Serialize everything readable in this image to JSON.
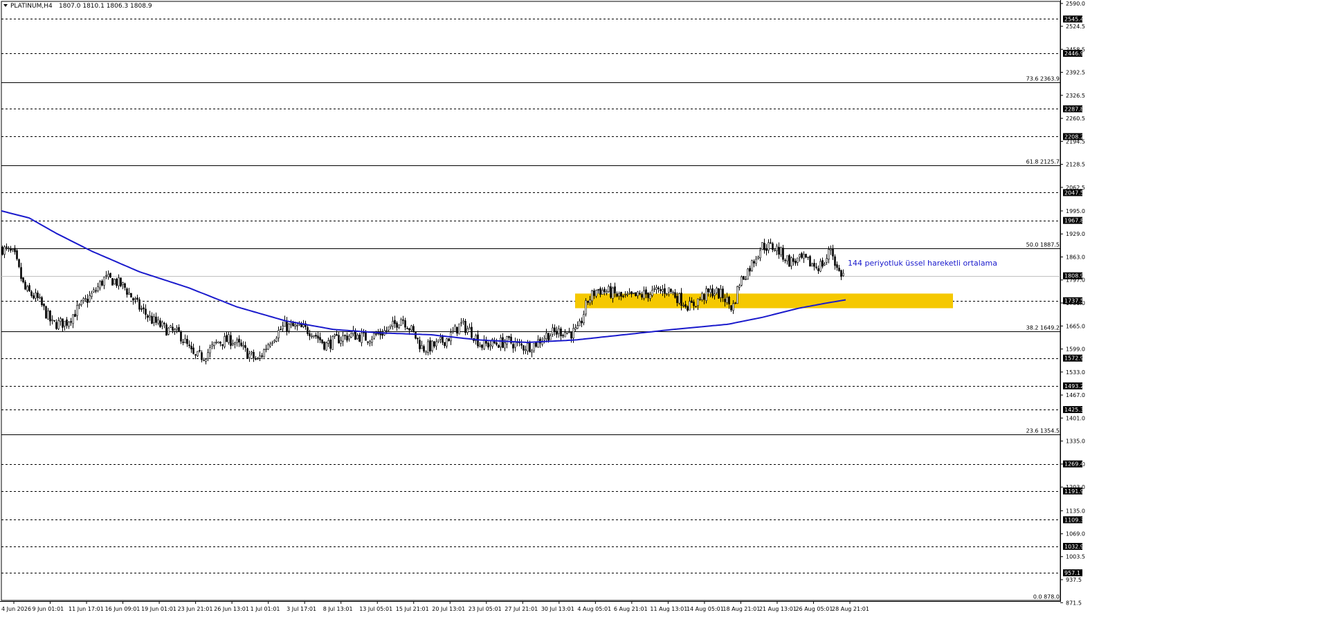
{
  "header": {
    "symbol": "PLATINUM,H4",
    "ohlc": "1807.0 1810.1 1806.3 1808.9"
  },
  "colors": {
    "background": "#ffffff",
    "candle": "#000000",
    "ema": "#1a1acc",
    "zone": "#f5c800",
    "annotation": "#1a1acc",
    "price_tag_bg": "#000000",
    "price_tag_text": "#ffffff"
  },
  "chart_data": {
    "type": "candlestick",
    "symbol": "PLATINUM",
    "timeframe": "H4",
    "ylim": [
      878.0,
      2590.0
    ],
    "price_scale_ticks": [
      "2590.0",
      "2524.5",
      "2458.5",
      "2392.5",
      "2326.5",
      "2260.5",
      "2194.5",
      "2128.5",
      "2062.5",
      "1995.0",
      "1929.0",
      "1863.0",
      "1797.0",
      "1731.0",
      "1665.0",
      "1599.0",
      "1533.0",
      "1467.0",
      "1401.0",
      "1335.0",
      "1269.0",
      "1203.0",
      "1135.0",
      "1069.0",
      "1003.5",
      "937.5",
      "871.5"
    ],
    "time_labels": [
      "4 Jun 2026",
      "9 Jun 01:01",
      "11 Jun 17:01",
      "16 Jun 09:01",
      "19 Jun 01:01",
      "23 Jun 21:01",
      "26 Jun 13:01",
      "1 Jul 01:01",
      "3 Jul 17:01",
      "8 Jul 13:01",
      "13 Jul 05:01",
      "15 Jul 21:01",
      "20 Jul 13:01",
      "23 Jul 05:01",
      "27 Jul 21:01",
      "30 Jul 13:01",
      "4 Aug 05:01",
      "6 Aug 21:01",
      "11 Aug 13:01",
      "14 Aug 05:01",
      "18 Aug 21:01",
      "21 Aug 13:01",
      "26 Aug 05:01",
      "28 Aug 21:01"
    ],
    "horizontal_levels": [
      {
        "price": 2545.4,
        "label": "2545.4"
      },
      {
        "price": 2446.9,
        "label": "2446.9"
      },
      {
        "price": 2287.8,
        "label": "2287.8"
      },
      {
        "price": 2208.2,
        "label": "2208.2"
      },
      {
        "price": 2047.5,
        "label": "2047.5"
      },
      {
        "price": 1967.8,
        "label": "1967.8"
      },
      {
        "price": 1737.5,
        "label": "1737.5"
      },
      {
        "price": 1572.9,
        "label": "1572.9"
      },
      {
        "price": 1493.2,
        "label": "1493.2"
      },
      {
        "price": 1425.3,
        "label": "1425.3"
      },
      {
        "price": 1269.4,
        "label": "1269.4"
      },
      {
        "price": 1191.9,
        "label": "1191.9"
      },
      {
        "price": 1109.3,
        "label": "1109.3"
      },
      {
        "price": 1032.9,
        "label": "1032.9"
      },
      {
        "price": 957.1,
        "label": "957.1"
      }
    ],
    "fibonacci_levels": [
      {
        "level": "73.6",
        "price": 2363.9,
        "label": "73.6 2363.9"
      },
      {
        "level": "61.8",
        "price": 2125.7,
        "label": "61.8 2125.7"
      },
      {
        "level": "50.0",
        "price": 1887.5,
        "label": "50.0 1887.5"
      },
      {
        "level": "38.2",
        "price": 1649.2,
        "label": "38.2 1649.2"
      },
      {
        "level": "23.6",
        "price": 1354.5,
        "label": "23.6 1354.5"
      },
      {
        "level": "0.0",
        "price": 878.0,
        "label": "0.0 878.0"
      }
    ],
    "current_price": {
      "price": 1808.9,
      "label": "1808.9"
    },
    "zone": {
      "price_top": 1758.0,
      "price_bottom": 1716.0,
      "start_label": "4 Aug 05:01",
      "end_label": "28 Aug 21:01"
    },
    "annotation": "144 periyotluk üssel hareketli ortalama",
    "price_path": [
      [
        0,
        1890
      ],
      [
        20,
        1870
      ],
      [
        35,
        1770
      ],
      [
        55,
        1740
      ],
      [
        75,
        1670
      ],
      [
        95,
        1675
      ],
      [
        115,
        1720
      ],
      [
        135,
        1760
      ],
      [
        150,
        1800
      ],
      [
        165,
        1795
      ],
      [
        180,
        1775
      ],
      [
        200,
        1720
      ],
      [
        220,
        1680
      ],
      [
        240,
        1655
      ],
      [
        260,
        1640
      ],
      [
        280,
        1575
      ],
      [
        295,
        1580
      ],
      [
        315,
        1620
      ],
      [
        335,
        1625
      ],
      [
        355,
        1590
      ],
      [
        372,
        1565
      ],
      [
        390,
        1625
      ],
      [
        410,
        1665
      ],
      [
        430,
        1660
      ],
      [
        450,
        1650
      ],
      [
        470,
        1610
      ],
      [
        490,
        1630
      ],
      [
        510,
        1640
      ],
      [
        530,
        1630
      ],
      [
        550,
        1645
      ],
      [
        565,
        1660
      ],
      [
        580,
        1690
      ],
      [
        595,
        1650
      ],
      [
        610,
        1600
      ],
      [
        630,
        1610
      ],
      [
        650,
        1635
      ],
      [
        665,
        1670
      ],
      [
        680,
        1650
      ],
      [
        695,
        1610
      ],
      [
        715,
        1615
      ],
      [
        735,
        1620
      ],
      [
        755,
        1605
      ],
      [
        770,
        1610
      ],
      [
        790,
        1640
      ],
      [
        810,
        1650
      ],
      [
        825,
        1645
      ],
      [
        835,
        1650
      ],
      [
        848,
        1735
      ],
      [
        862,
        1770
      ],
      [
        880,
        1762
      ],
      [
        900,
        1745
      ],
      [
        920,
        1750
      ],
      [
        940,
        1760
      ],
      [
        965,
        1770
      ],
      [
        980,
        1745
      ],
      [
        997,
        1720
      ],
      [
        1015,
        1750
      ],
      [
        1030,
        1765
      ],
      [
        1045,
        1750
      ],
      [
        1058,
        1715
      ],
      [
        1068,
        1790
      ],
      [
        1082,
        1830
      ],
      [
        1100,
        1895
      ],
      [
        1120,
        1890
      ],
      [
        1140,
        1850
      ],
      [
        1160,
        1855
      ],
      [
        1180,
        1835
      ],
      [
        1192,
        1848
      ],
      [
        1200,
        1890
      ],
      [
        1210,
        1822
      ],
      [
        1220,
        1808.9
      ]
    ],
    "ema_144_path": [
      [
        0,
        1995
      ],
      [
        40,
        1975
      ],
      [
        80,
        1930
      ],
      [
        130,
        1880
      ],
      [
        200,
        1820
      ],
      [
        270,
        1775
      ],
      [
        340,
        1720
      ],
      [
        410,
        1680
      ],
      [
        480,
        1655
      ],
      [
        550,
        1645
      ],
      [
        620,
        1640
      ],
      [
        690,
        1625
      ],
      [
        760,
        1618
      ],
      [
        830,
        1625
      ],
      [
        900,
        1640
      ],
      [
        970,
        1655
      ],
      [
        1050,
        1670
      ],
      [
        1100,
        1690
      ],
      [
        1150,
        1715
      ],
      [
        1190,
        1730
      ],
      [
        1220,
        1740
      ]
    ]
  }
}
